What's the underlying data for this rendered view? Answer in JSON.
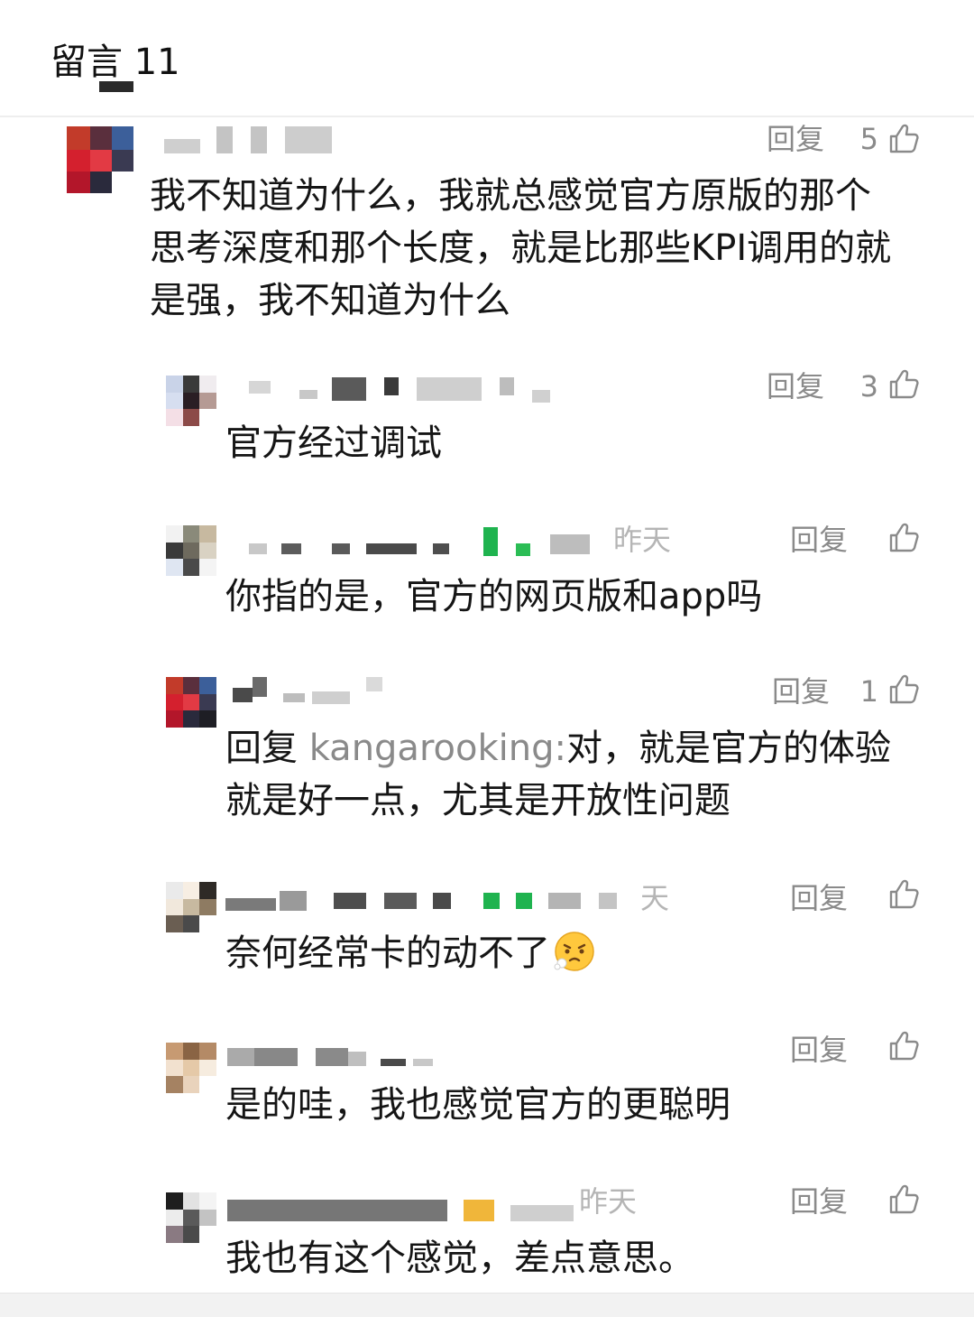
{
  "header": {
    "title": "留言 11"
  },
  "comments": [
    {
      "reply_label": "回复",
      "likes": "5",
      "text": "我不知道为什么，我就总感觉官方原版的那个\n思考深度和那个长度，就是比那些KPI调用的就\n是强，我不知道为什么"
    },
    {
      "reply_label": "回复",
      "likes": "3",
      "text": "官方经过调试"
    },
    {
      "time": "昨天",
      "reply_label": "回复",
      "likes": "",
      "text": "你指的是，官方的网页版和app吗"
    },
    {
      "reply_label": "回复",
      "likes": "1",
      "reply_prefix": "回复",
      "reply_to": "kangarooking",
      "reply_sep": ":",
      "text_line1": "对，就是官方的体验",
      "text_line2": "就是好一点，尤其是开放性问题"
    },
    {
      "time": "天",
      "reply_label": "回复",
      "likes": "",
      "text": "奈何经常卡的动不了"
    },
    {
      "reply_label": "回复",
      "likes": "",
      "text": "是的哇，我也感觉官方的更聪明"
    },
    {
      "time": "昨天",
      "reply_label": "回复",
      "likes": "",
      "text": "我也有这个感觉，差点意思。"
    }
  ],
  "icons": {
    "like": "thumbs-up-icon",
    "emoji": "dizzy-face-emoji-icon"
  },
  "colors": {
    "reply": "#8a8a8a",
    "time": "#b5b5b5",
    "text": "#151515",
    "divider": "#eeeeee"
  }
}
